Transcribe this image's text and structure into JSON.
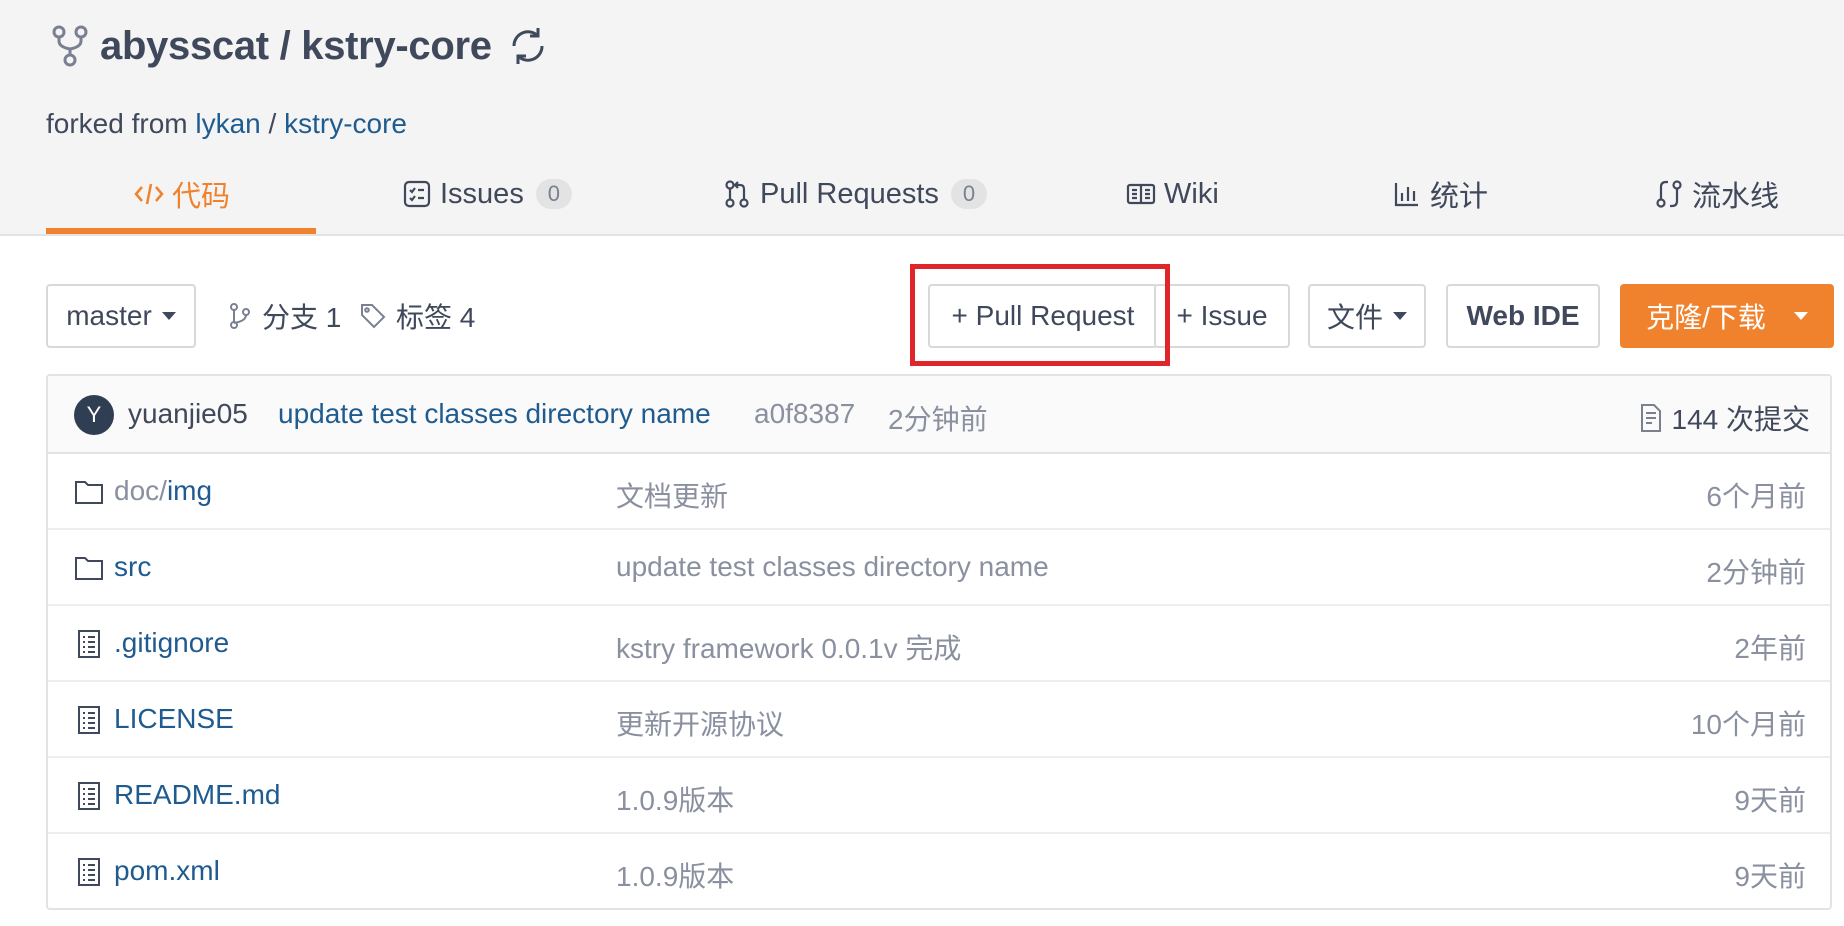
{
  "repo": {
    "owner": "abysscat",
    "separator": "/",
    "name": "kstry-core",
    "title": "abysscat / kstry-core",
    "forked_prefix": "forked from",
    "forked_owner": "lykan",
    "forked_sep": "/",
    "forked_repo": "kstry-core"
  },
  "tabs": [
    {
      "label": "代码",
      "icon": "code-icon",
      "active": true
    },
    {
      "label": "Issues",
      "icon": "issues-icon",
      "count": "0"
    },
    {
      "label": "Pull Requests",
      "icon": "pull-request-icon",
      "count": "0"
    },
    {
      "label": "Wiki",
      "icon": "book-icon"
    },
    {
      "label": "统计",
      "icon": "bar-chart-icon"
    },
    {
      "label": "流水线",
      "icon": "pipeline-icon"
    }
  ],
  "toolbar": {
    "branch": "master",
    "branches_label": "分支 1",
    "tags_label": "标签 4",
    "pull_request_btn": "+ Pull Request",
    "issue_btn": "+ Issue",
    "file_btn": "文件",
    "webide_btn": "Web IDE",
    "clone_btn": "克隆/下载"
  },
  "last_commit": {
    "avatar_letter": "Y",
    "author": "yuanjie05",
    "message": "update test classes directory name",
    "sha": "a0f8387",
    "time": "2分钟前",
    "commits_label": "144 次提交"
  },
  "files": [
    {
      "type": "folder",
      "prefix": "doc/",
      "name": "img",
      "message": "文档更新",
      "time": "6个月前"
    },
    {
      "type": "folder",
      "prefix": "",
      "name": "src",
      "message": "update test classes directory name",
      "time": "2分钟前"
    },
    {
      "type": "file",
      "prefix": "",
      "name": ".gitignore",
      "message": "kstry framework 0.0.1v 完成",
      "time": "2年前"
    },
    {
      "type": "file",
      "prefix": "",
      "name": "LICENSE",
      "message": "更新开源协议",
      "time": "10个月前"
    },
    {
      "type": "file",
      "prefix": "",
      "name": "README.md",
      "message": "1.0.9版本",
      "time": "9天前"
    },
    {
      "type": "file",
      "prefix": "",
      "name": "pom.xml",
      "message": "1.0.9版本",
      "time": "9天前"
    }
  ],
  "colors": {
    "accent": "#f0822d",
    "link": "#1f5b8f",
    "highlight": "#e0262a"
  }
}
